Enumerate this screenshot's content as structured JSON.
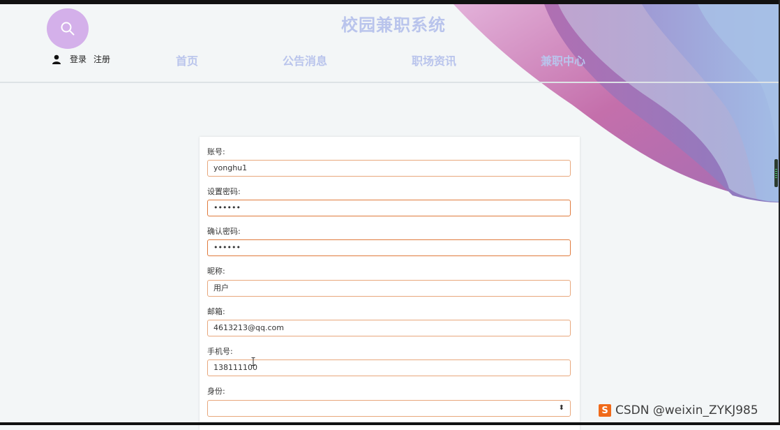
{
  "header": {
    "title": "校园兼职系统",
    "search_icon": "search-icon",
    "auth": {
      "login": "登录",
      "register": "注册"
    },
    "nav": [
      "首页",
      "公告消息",
      "职场资讯",
      "兼职中心"
    ]
  },
  "form": {
    "fields": [
      {
        "label": "账号:",
        "value": "yonghu1"
      },
      {
        "label": "设置密码:",
        "value": "••••••"
      },
      {
        "label": "确认密码:",
        "value": "••••••"
      },
      {
        "label": "昵称:",
        "value": "用户"
      },
      {
        "label": "邮箱:",
        "value": "4613213@qq.com"
      },
      {
        "label": "手机号:",
        "value": "138111100"
      },
      {
        "label": "身份:",
        "value": ""
      }
    ]
  },
  "watermark": {
    "ime_glyph": "S",
    "text": "CSDN @weixin_ZYKJ985"
  },
  "colors": {
    "page_bg": "#f3f6f7",
    "title": "#b9c4ec",
    "search_circle": "#d4b0ea",
    "input_border": "#e8a77c",
    "wave_pink": "#c873ac",
    "wave_blue": "#9fb6df"
  }
}
